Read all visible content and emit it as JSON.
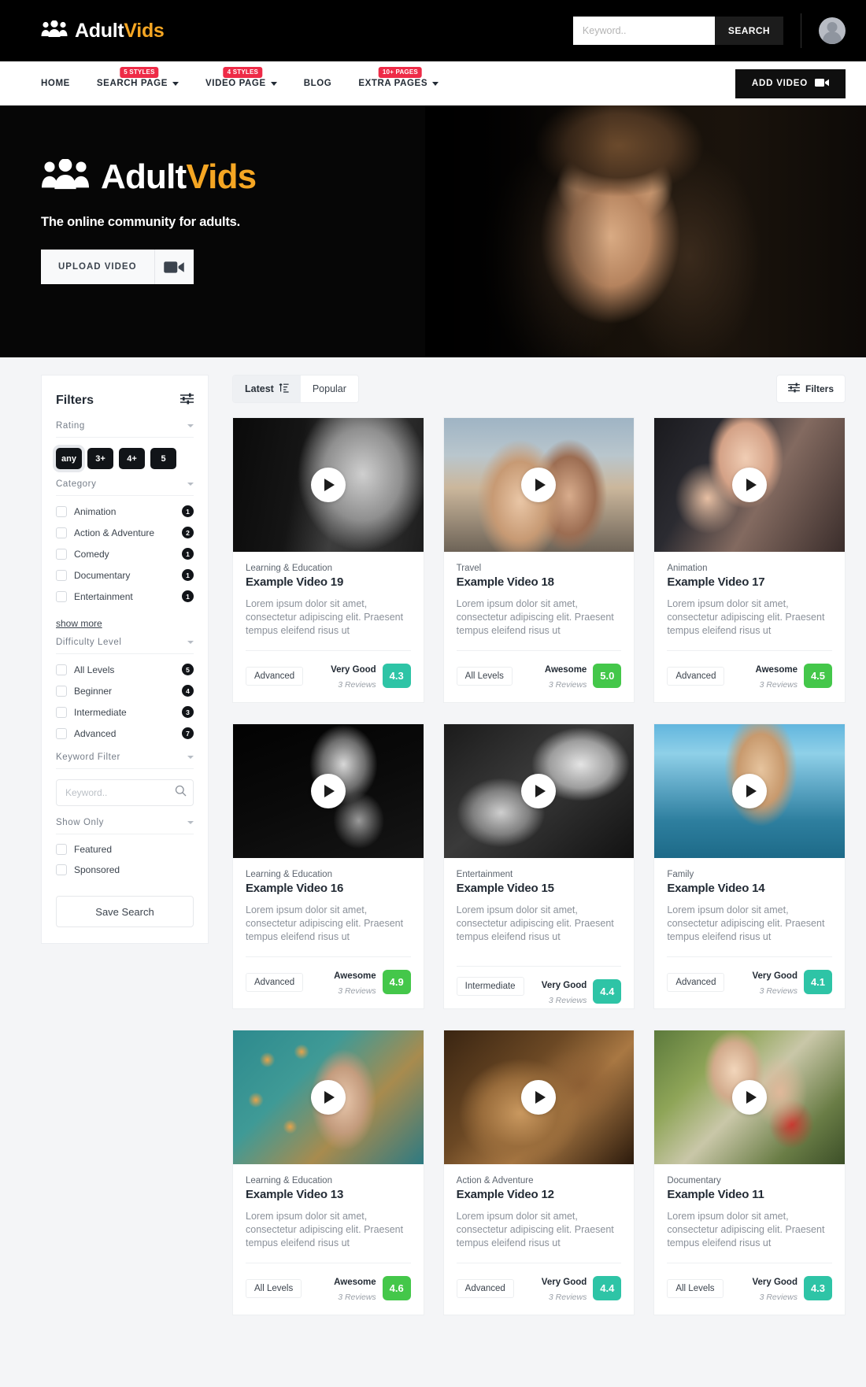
{
  "brand": {
    "name_part1": "Adult",
    "name_part2": "Vids",
    "icon": "group-icon"
  },
  "topbar": {
    "search_placeholder": "Keyword..",
    "search_value": "",
    "search_button": "SEARCH",
    "avatar": "user-avatar"
  },
  "nav": {
    "items": [
      {
        "label": "HOME",
        "badge": null,
        "caret": false
      },
      {
        "label": "SEARCH PAGE",
        "badge": "5 STYLES",
        "caret": true
      },
      {
        "label": "VIDEO PAGE",
        "badge": "4 STYLES",
        "caret": true
      },
      {
        "label": "BLOG",
        "badge": null,
        "caret": false
      },
      {
        "label": "EXTRA PAGES",
        "badge": "10+ PAGES",
        "caret": true
      }
    ],
    "add_video": "ADD VIDEO",
    "badge_color": "#ee2b47"
  },
  "hero": {
    "logo_part1": "Adult",
    "logo_part2": "Vids",
    "tagline": "The online community for adults.",
    "upload_label": "UPLOAD VIDEO",
    "accent_color": "#f5a623"
  },
  "sidebar": {
    "title": "Filters",
    "groups": {
      "rating": {
        "label": "Rating",
        "pills": [
          {
            "label": "any",
            "selected": true
          },
          {
            "label": "3+",
            "selected": false
          },
          {
            "label": "4+",
            "selected": false
          },
          {
            "label": "5",
            "selected": false
          }
        ]
      },
      "category": {
        "label": "Category",
        "items": [
          {
            "label": "Animation",
            "count": "1"
          },
          {
            "label": "Action & Adventure",
            "count": "2"
          },
          {
            "label": "Comedy",
            "count": "1"
          },
          {
            "label": "Documentary",
            "count": "1"
          },
          {
            "label": "Entertainment",
            "count": "1"
          }
        ],
        "show_more": "show more"
      },
      "difficulty": {
        "label": "Difficulty Level",
        "items": [
          {
            "label": "All Levels",
            "count": "5"
          },
          {
            "label": "Beginner",
            "count": "4"
          },
          {
            "label": "Intermediate",
            "count": "3"
          },
          {
            "label": "Advanced",
            "count": "7"
          }
        ]
      },
      "keyword": {
        "label": "Keyword Filter",
        "placeholder": "Keyword..",
        "value": ""
      },
      "show_only": {
        "label": "Show Only",
        "items": [
          {
            "label": "Featured"
          },
          {
            "label": "Sponsored"
          }
        ]
      }
    },
    "save_search": "Save Search"
  },
  "main": {
    "tabs": [
      {
        "label": "Latest",
        "active": true,
        "icon": "sort-icon"
      },
      {
        "label": "Popular",
        "active": false,
        "icon": null
      }
    ],
    "filters_button": "Filters",
    "cards": [
      {
        "category": "Learning & Education",
        "title": "Example Video 19",
        "description": "Lorem ipsum dolor sit amet, consectetur adipiscing elit. Praesent tempus eleifend risus ut",
        "level": "Advanced",
        "rating_label": "Very Good",
        "reviews": "3 Reviews",
        "score": "4.3",
        "score_color": "#2ec4a6",
        "thumb": "portrait-bw-woman",
        "offset": false
      },
      {
        "category": "Travel",
        "title": "Example Video 18",
        "description": "Lorem ipsum dolor sit amet, consectetur adipiscing elit. Praesent tempus eleifend risus ut",
        "level": "All Levels",
        "rating_label": "Awesome",
        "reviews": "3 Reviews",
        "score": "5.0",
        "score_color": "#44c74a",
        "thumb": "beach-couple",
        "offset": false
      },
      {
        "category": "Animation",
        "title": "Example Video 17",
        "description": "Lorem ipsum dolor sit amet, consectetur adipiscing elit. Praesent tempus eleifend risus ut",
        "level": "Advanced",
        "rating_label": "Awesome",
        "reviews": "3 Reviews",
        "score": "4.5",
        "score_color": "#44c74a",
        "thumb": "tattoo-woman",
        "offset": false
      },
      {
        "category": "Learning & Education",
        "title": "Example Video 16",
        "description": "Lorem ipsum dolor sit amet, consectetur adipiscing elit. Praesent tempus eleifend risus ut",
        "level": "Advanced",
        "rating_label": "Awesome",
        "reviews": "3 Reviews",
        "score": "4.9",
        "score_color": "#44c74a",
        "thumb": "dark-profile",
        "offset": false
      },
      {
        "category": "Entertainment",
        "title": "Example Video 15",
        "description": "Lorem ipsum dolor sit amet, consectetur adipiscing elit. Praesent tempus eleifend risus ut",
        "level": "Intermediate",
        "rating_label": "Very Good",
        "reviews": "3 Reviews",
        "score": "4.4",
        "score_color": "#2ec4a6",
        "thumb": "headphones-bw",
        "offset": true
      },
      {
        "category": "Family",
        "title": "Example Video 14",
        "description": "Lorem ipsum dolor sit amet, consectetur adipiscing elit. Praesent tempus eleifend risus ut",
        "level": "Advanced",
        "rating_label": "Very Good",
        "reviews": "3 Reviews",
        "score": "4.1",
        "score_color": "#2ec4a6",
        "thumb": "ocean-swimsuit",
        "offset": false
      },
      {
        "category": "Learning & Education",
        "title": "Example Video 13",
        "description": "Lorem ipsum dolor sit amet, consectetur adipiscing elit. Praesent tempus eleifend risus ut",
        "level": "All Levels",
        "rating_label": "Awesome",
        "reviews": "3 Reviews",
        "score": "4.6",
        "score_color": "#44c74a",
        "thumb": "hat-mosaic",
        "offset": false
      },
      {
        "category": "Action & Adventure",
        "title": "Example Video 12",
        "description": "Lorem ipsum dolor sit amet, consectetur adipiscing elit. Praesent tempus eleifend risus ut",
        "level": "Advanced",
        "rating_label": "Very Good",
        "reviews": "3 Reviews",
        "score": "4.4",
        "score_color": "#2ec4a6",
        "thumb": "wet-skin",
        "offset": false
      },
      {
        "category": "Documentary",
        "title": "Example Video 11",
        "description": "Lorem ipsum dolor sit amet, consectetur adipiscing elit. Praesent tempus eleifend risus ut",
        "level": "All Levels",
        "rating_label": "Very Good",
        "reviews": "3 Reviews",
        "score": "4.3",
        "score_color": "#2ec4a6",
        "thumb": "couple-garden",
        "offset": false
      }
    ]
  }
}
